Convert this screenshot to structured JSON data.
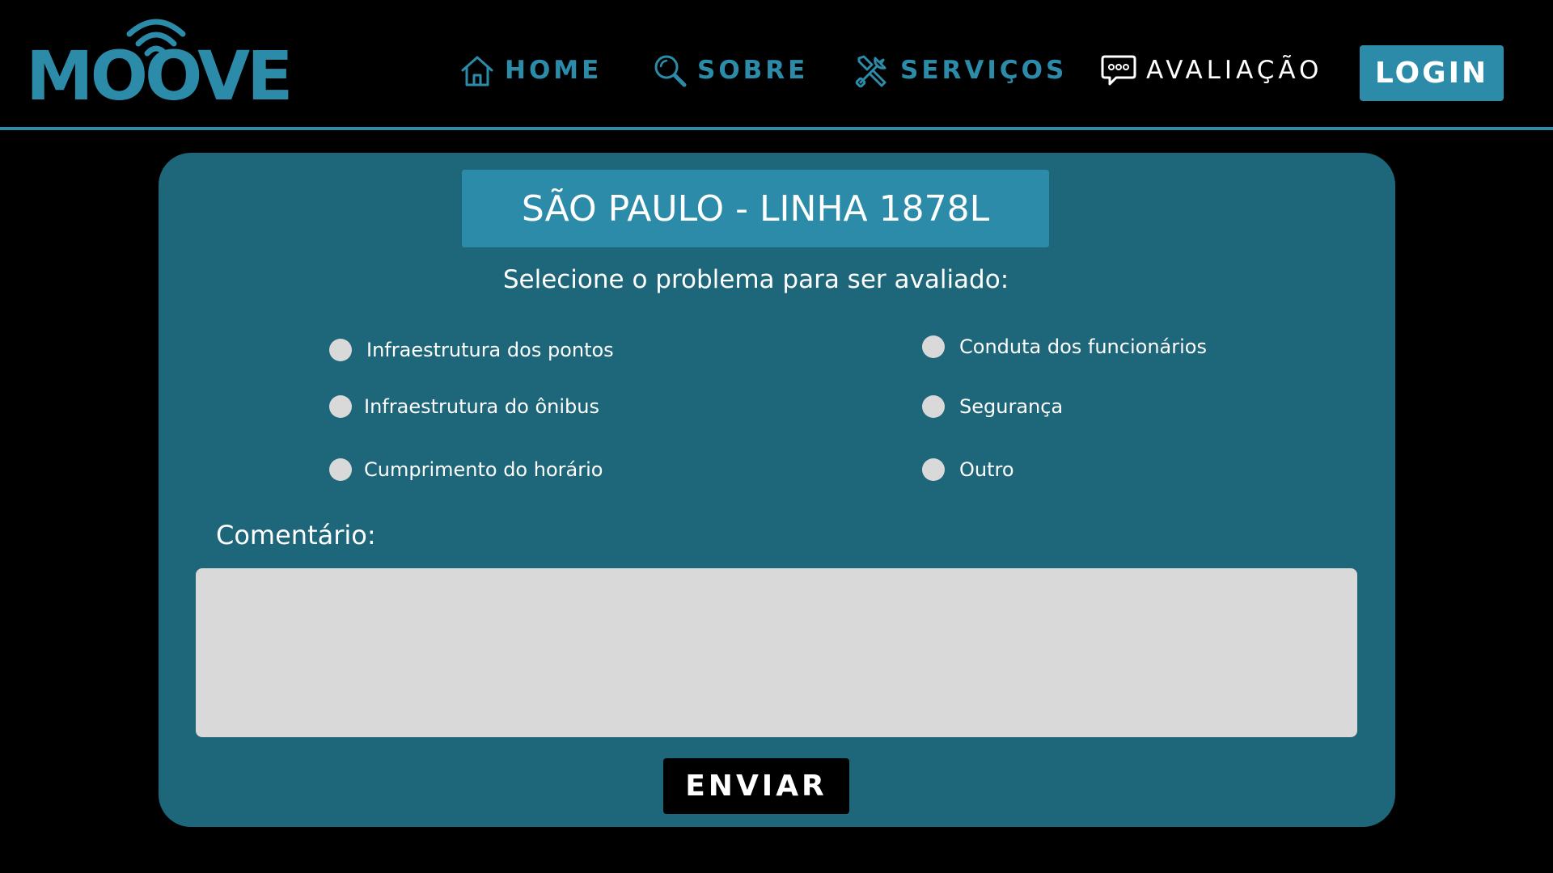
{
  "brand": {
    "logo_text": "MOOVE",
    "accent_color": "#2b8ba8",
    "card_color": "#1e6679",
    "background_color": "#000000"
  },
  "nav": {
    "items": [
      {
        "label": "HOME",
        "icon": "home-icon",
        "active": false
      },
      {
        "label": "SOBRE",
        "icon": "search-icon",
        "active": false
      },
      {
        "label": "SERVIÇOS",
        "icon": "tools-icon",
        "active": false
      },
      {
        "label": "AVALIAÇÃO",
        "icon": "chat-bubble-icon",
        "active": true
      }
    ],
    "login_label": "LOGIN"
  },
  "form": {
    "title": "SÃO PAULO - LINHA 1878L",
    "subtitle": "Selecione o problema para ser avaliado:",
    "options": [
      {
        "label": "Infraestrutura dos pontos"
      },
      {
        "label": "Infraestrutura do ônibus"
      },
      {
        "label": "Cumprimento do horário"
      },
      {
        "label": "Conduta dos funcionários"
      },
      {
        "label": "Segurança"
      },
      {
        "label": "Outro"
      }
    ],
    "comment_label": "Comentário:",
    "comment_value": "",
    "submit_label": "ENVIAR"
  }
}
